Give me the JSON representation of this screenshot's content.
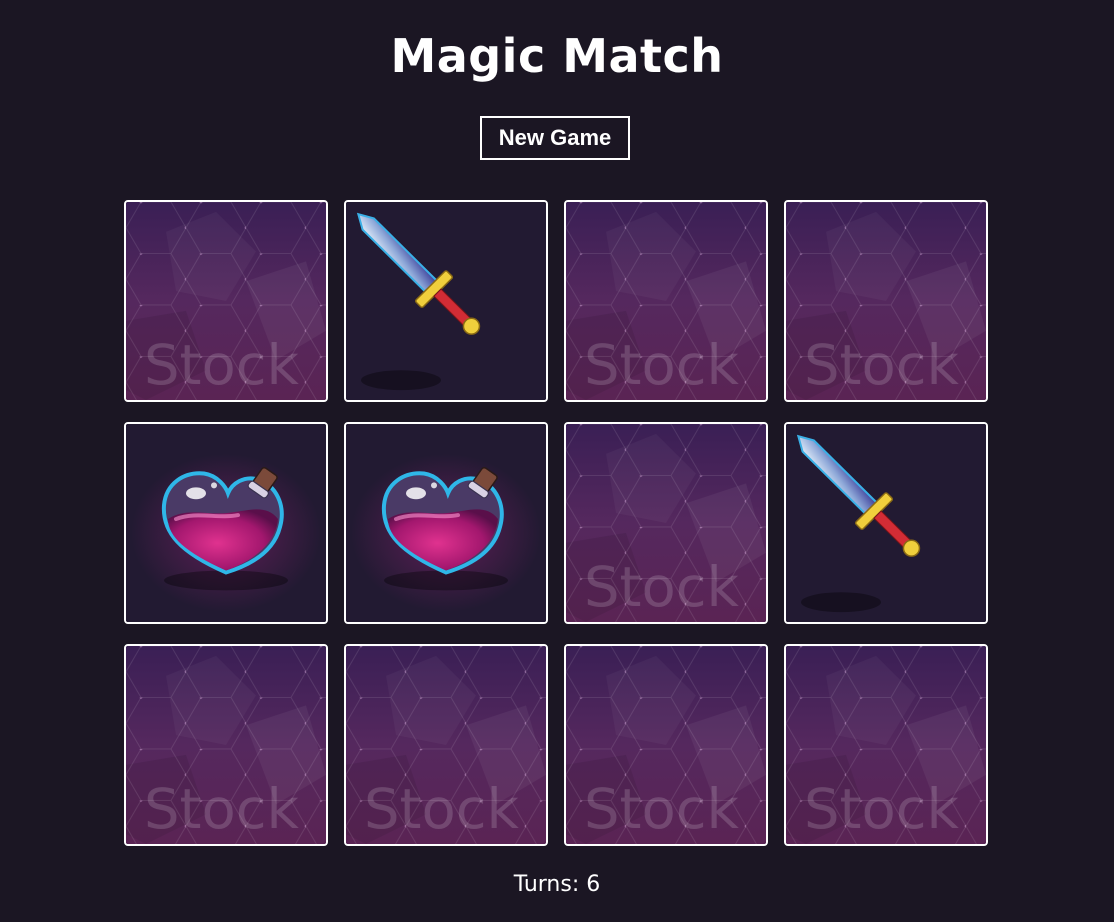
{
  "title": "Magic Match",
  "new_game_label": "New Game",
  "turns_label": "Turns: 6",
  "card_back_watermark": "Stock",
  "cards": [
    {
      "state": "back",
      "icon": null
    },
    {
      "state": "face",
      "icon": "sword-icon"
    },
    {
      "state": "back",
      "icon": null
    },
    {
      "state": "back",
      "icon": null
    },
    {
      "state": "face",
      "icon": "potion-icon"
    },
    {
      "state": "face",
      "icon": "potion-icon"
    },
    {
      "state": "back",
      "icon": null
    },
    {
      "state": "face",
      "icon": "sword-icon"
    },
    {
      "state": "back",
      "icon": null
    },
    {
      "state": "back",
      "icon": null
    },
    {
      "state": "back",
      "icon": null
    },
    {
      "state": "back",
      "icon": null
    }
  ],
  "colors": {
    "background": "#1b1623",
    "card_back": "#4e2456",
    "card_face": "#221a32",
    "border": "#ffffff"
  }
}
